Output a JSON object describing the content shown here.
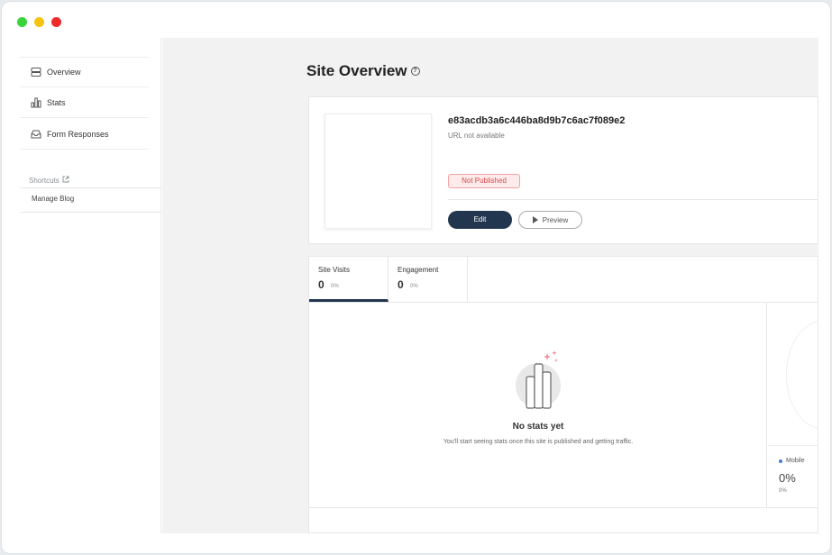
{
  "sidebar": {
    "items": [
      {
        "label": "Overview",
        "icon": "server-icon"
      },
      {
        "label": "Stats",
        "icon": "bar-chart-icon"
      },
      {
        "label": "Form Responses",
        "icon": "inbox-icon"
      }
    ],
    "shortcuts_label": "Shortcuts",
    "manage_blog": "Manage Blog"
  },
  "main": {
    "title": "Site Overview",
    "site": {
      "id": "e83acdb3a6c446ba8d9b7c6ac7f089e2",
      "url": "URL not available",
      "status": "Not Published",
      "edit_label": "Edit",
      "preview_label": "Preview"
    },
    "tabs": [
      {
        "label": "Site Visits",
        "value": "0",
        "pct": "0%"
      },
      {
        "label": "Engagement",
        "value": "0",
        "pct": "0%"
      }
    ],
    "empty": {
      "title": "No stats yet",
      "subtitle": "You'll start seeing stats once this site is published and getting traffic."
    },
    "device": {
      "label": "Mobile",
      "value": "0%",
      "sub": "0%"
    }
  },
  "colors": {
    "primary": "#22374f",
    "badge_text": "#d94a4a",
    "badge_bg": "#fdeaea",
    "mobile_dot": "#4a7bd0"
  }
}
